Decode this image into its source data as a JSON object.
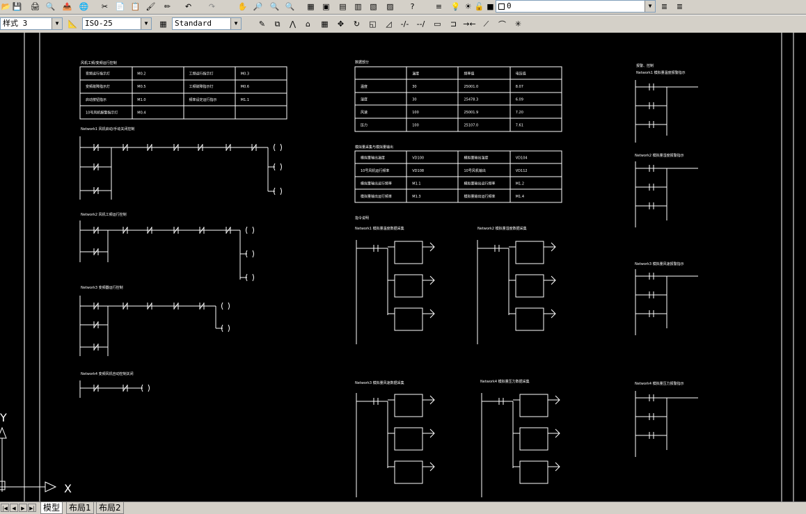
{
  "toolbar": {
    "layer_value": "0",
    "style_left": "样式 3",
    "dim_style": "ISO-25",
    "table_style": "Standard"
  },
  "drawing": {
    "table1_title": "风机工频/变频运行控制",
    "table1_rows": [
      [
        "变频运行指示灯",
        "M0.2",
        "工频运行指示灯",
        "M0.3"
      ],
      [
        "变频故障指示灯",
        "M0.5",
        "工频故障指示灯",
        "M0.6"
      ],
      [
        "启动按钮指示",
        "M1.0",
        "频率设定运行指示",
        "M1.1"
      ],
      [
        "10号风机报警指示灯",
        "M0.4",
        "",
        ""
      ]
    ],
    "net1_title": "Network1  风机启动/手动关闭控制",
    "net2_title": "Network2  风机工频运行控制",
    "net3_title": "Network3  变频器运行控制",
    "net4_title": "Network4  变频风机自动控制关闭",
    "table2_title": "数据部分",
    "table2_header": [
      "",
      "温度",
      "频率值",
      "电压值"
    ],
    "table2_rows": [
      [
        "温度",
        "30",
        "25001.0",
        "8.07"
      ],
      [
        "湿度",
        "30",
        "25478.3",
        "6.09"
      ],
      [
        "风速",
        "100",
        "25001.9",
        "7.20"
      ],
      [
        "压力",
        "100",
        "25107.0",
        "7.61"
      ]
    ],
    "table3_title": "模拟量采集与模拟量输出",
    "table3_rows": [
      [
        "模拟量输出温度",
        "VD100",
        "模拟量输出湿度",
        "VD104"
      ],
      [
        "10号风机运行频率",
        "VD108",
        "10号风机输出",
        "VD112"
      ],
      [
        "模拟量输出运行频率",
        "M1.1",
        "模拟量输出运行频率",
        "M1.2"
      ],
      [
        "模拟量输出运行频率",
        "M1.3",
        "模拟量输出运行频率",
        "M1.4"
      ]
    ],
    "analog_title": "指令说明",
    "net_analog1": "Network1  模拟量温度数据采集",
    "net_analog2": "Network2  模拟量湿度数据采集",
    "net_analog3": "Network3  模拟量风速数据采集",
    "net_analog4": "Network4  模拟量压力数据采集",
    "right_title": "报警、控制",
    "net_r1": "Network1  模拟量温度报警指示",
    "net_r2": "Network2  模拟量湿度报警指示",
    "net_r3": "Network3  模拟量风速报警指示",
    "net_r4": "Network4  模拟量压力报警指示"
  },
  "tabs": [
    "模型",
    "布局1",
    "布局2"
  ],
  "ucs": {
    "x": "X",
    "y": "Y"
  }
}
